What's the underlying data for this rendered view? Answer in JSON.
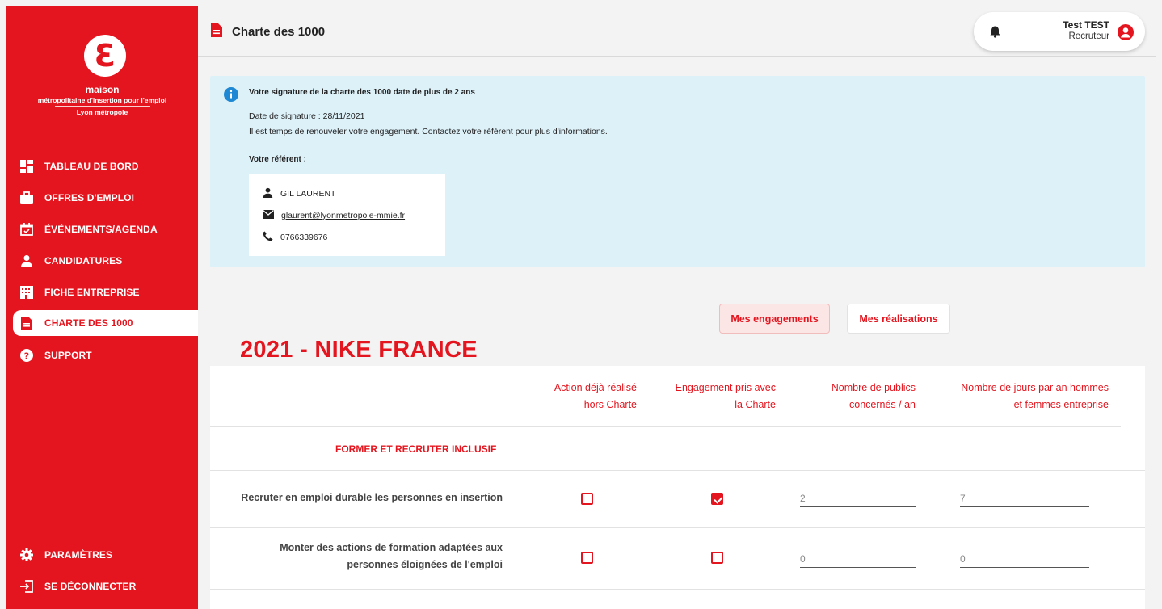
{
  "sidebar": {
    "logo": {
      "glyph": "Ɛ",
      "name": "maison",
      "subtitle": "métropolitaine d'insertion pour l'emploi",
      "city": "Lyon métropole"
    },
    "items": [
      {
        "label": "TABLEAU DE BORD",
        "icon": "dashboard-icon"
      },
      {
        "label": "OFFRES D'EMPLOI",
        "icon": "briefcase-icon"
      },
      {
        "label": "ÉVÉNEMENTS/AGENDA",
        "icon": "calendar-icon"
      },
      {
        "label": "CANDIDATURES",
        "icon": "person-icon"
      },
      {
        "label": "FICHE ENTREPRISE",
        "icon": "building-icon"
      },
      {
        "label": "CHARTE DES 1000",
        "icon": "document-icon",
        "active": true
      },
      {
        "label": "SUPPORT",
        "icon": "help-icon"
      }
    ],
    "bottom_items": [
      {
        "label": "PARAMÈTRES",
        "icon": "gear-icon"
      },
      {
        "label": "SE DÉCONNECTER",
        "icon": "logout-icon"
      }
    ]
  },
  "header": {
    "title": "Charte des 1000",
    "user": {
      "name": "Test TEST",
      "role": "Recruteur"
    }
  },
  "info": {
    "title": "Votre signature de la charte des 1000 date de plus de 2 ans",
    "date_line": "Date de signature : 28/11/2021",
    "message": "Il est temps de renouveler votre engagement. Contactez votre référent pour plus d'informations.",
    "referent_label": "Votre référent :",
    "referent": {
      "name": "GIL LAURENT",
      "email": "glaurent@lyonmetropole-mmie.fr",
      "phone": "0766339676"
    }
  },
  "tabs": {
    "engagements": "Mes engagements",
    "realisations": "Mes réalisations"
  },
  "year_title": "2021 - NIKE FRANCE",
  "table": {
    "headers": [
      [
        "Action déjà réalisé",
        "hors Charte"
      ],
      [
        "Engagement pris avec",
        "la Charte"
      ],
      [
        "Nombre de publics",
        "concernés / an"
      ],
      [
        "Nombre de jours par an hommes",
        "et femmes entreprise"
      ]
    ],
    "section": "FORMER ET RECRUTER INCLUSIF",
    "rows": [
      {
        "label": [
          "Recruter en emploi durable les personnes en insertion"
        ],
        "hors_charte": false,
        "charte": true,
        "publics": "2",
        "jours": "7"
      },
      {
        "label": [
          "Monter des actions de formation adaptées aux",
          "personnes éloignées de l'emploi"
        ],
        "hors_charte": false,
        "charte": false,
        "publics": "0",
        "jours": "0"
      }
    ]
  },
  "colors": {
    "brand_red": "#e4151e",
    "info_bg": "#ddf1f9",
    "tab_active_bg": "#fbe5e5"
  }
}
